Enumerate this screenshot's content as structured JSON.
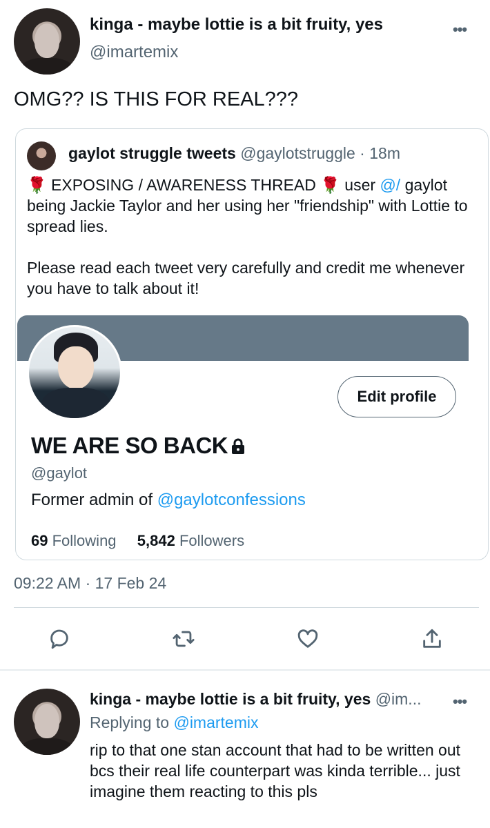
{
  "tweet": {
    "author_name": "kinga - maybe lottie is a bit fruity, yes",
    "author_handle": "@imartemix",
    "text": "OMG?? IS THIS FOR REAL???",
    "more_glyph": "•••",
    "timestamp": "09:22 AM · 17 Feb 24"
  },
  "quote": {
    "author_name": "gaylot struggle tweets",
    "author_handle": "@gaylotstruggle",
    "separator": " · ",
    "time": "18m",
    "rose": "🌹",
    "line1_a": " EXPOSING / AWARENESS THREAD ",
    "line1_b": " user ",
    "mention": "@/",
    "line1_c": " gaylot being Jackie Taylor and her using her \"friendship\" with Lottie to spread lies.",
    "paragraph2": "Please read each tweet very carefully and credit me whenever you have to talk about it!"
  },
  "profile_card": {
    "edit_button": "Edit profile",
    "name": "WE ARE SO BACK",
    "handle": "@gaylot",
    "bio_prefix": "Former admin of ",
    "bio_link": "@gaylotconfessions",
    "following_count": "69",
    "following_label": "Following",
    "followers_count": "5,842",
    "followers_label": "Followers"
  },
  "actions": {
    "icons": [
      "reply-icon",
      "retweet-icon",
      "like-icon",
      "share-icon"
    ]
  },
  "reply": {
    "author_name": "kinga - maybe lottie is a bit fruity, yes",
    "author_handle_truncated": "@im...",
    "replying_prefix": "Replying to ",
    "replying_handle": "@imartemix",
    "text": "rip to that one stan account that had to be written out bcs their real life counterpart was kinda terrible... just imagine them reacting to this pls",
    "more_glyph": "•••"
  },
  "colors": {
    "text": "#0f1419",
    "secondary": "#536471",
    "link": "#1d9bf0",
    "border": "#cfd9de",
    "banner": "#667988"
  }
}
